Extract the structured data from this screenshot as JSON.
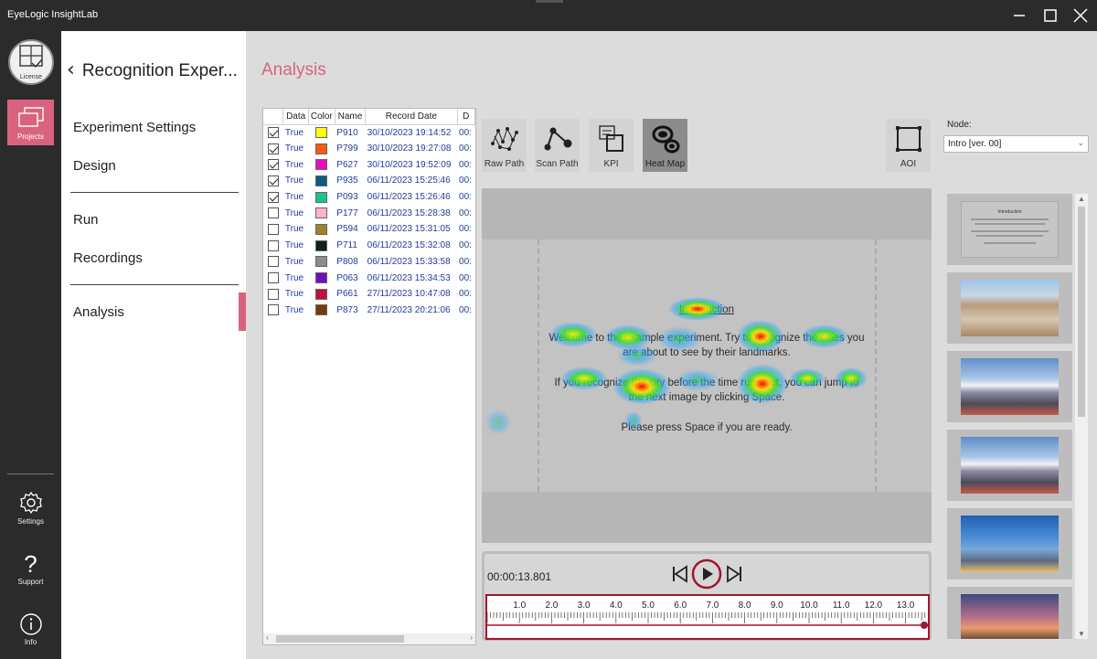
{
  "window": {
    "title": "EyeLogic InsightLab"
  },
  "rail": {
    "license": "License",
    "projects": "Projects",
    "settings": "Settings",
    "support": "Support",
    "info": "Info"
  },
  "sidemenu": {
    "back_title": "Recognition Exper...",
    "items": [
      "Experiment Settings",
      "Design",
      "Run",
      "Recordings",
      "Analysis"
    ]
  },
  "page_title": "Analysis",
  "table": {
    "headers": [
      "Data",
      "Color",
      "Name",
      "Record Date",
      "D"
    ],
    "rows": [
      {
        "checked": true,
        "data": "True",
        "color": "#ffff00",
        "name": "P910",
        "date": "30/10/2023 19:14:52",
        "d": "00:"
      },
      {
        "checked": true,
        "data": "True",
        "color": "#ff5a14",
        "name": "P799",
        "date": "30/10/2023 19:27:08",
        "d": "00:"
      },
      {
        "checked": true,
        "data": "True",
        "color": "#e60fbe",
        "name": "P627",
        "date": "30/10/2023 19:52:09",
        "d": "00:"
      },
      {
        "checked": true,
        "data": "True",
        "color": "#0f5a82",
        "name": "P935",
        "date": "06/11/2023 15:25:46",
        "d": "00:"
      },
      {
        "checked": true,
        "data": "True",
        "color": "#19c38c",
        "name": "P093",
        "date": "06/11/2023 15:26:46",
        "d": "00:"
      },
      {
        "checked": false,
        "data": "True",
        "color": "#ffb4c8",
        "name": "P177",
        "date": "06/11/2023 15:28:38",
        "d": "00:"
      },
      {
        "checked": false,
        "data": "True",
        "color": "#a08228",
        "name": "P594",
        "date": "06/11/2023 15:31:05",
        "d": "00:"
      },
      {
        "checked": false,
        "data": "True",
        "color": "#0f1e1e",
        "name": "P711",
        "date": "06/11/2023 15:32:08",
        "d": "00:"
      },
      {
        "checked": false,
        "data": "True",
        "color": "#8c8c8c",
        "name": "P808",
        "date": "06/11/2023 15:33:58",
        "d": "00:"
      },
      {
        "checked": false,
        "data": "True",
        "color": "#6e0fbe",
        "name": "P063",
        "date": "06/11/2023 15:34:53",
        "d": "00:"
      },
      {
        "checked": false,
        "data": "True",
        "color": "#c30f3c",
        "name": "P661",
        "date": "27/11/2023 10:47:08",
        "d": "00:"
      },
      {
        "checked": false,
        "data": "True",
        "color": "#783c0a",
        "name": "P873",
        "date": "27/11/2023 20:21:06",
        "d": "00:"
      }
    ]
  },
  "tools": {
    "raw_path": "Raw Path",
    "scan_path": "Scan Path",
    "kpi": "KPI",
    "heat_map": "Heat Map",
    "aoi": "AOI"
  },
  "node": {
    "label": "Node:",
    "value": "Intro [ver. 00]"
  },
  "slide": {
    "heading": "Introduction",
    "line1": "Welcome to the example experiment. Try to recognize the cities you",
    "line2": "are about to see by their landmarks.",
    "line3": "If you recognize the city before the time runs out, you can jump to",
    "line4": "the next image by clicking Space.",
    "line5": "Please press Space if you are ready."
  },
  "player": {
    "time": "00:00:13.801",
    "ticks": [
      "1.0",
      "2.0",
      "3.0",
      "4.0",
      "5.0",
      "6.0",
      "7.0",
      "8.0",
      "9.0",
      "10.0",
      "11.0",
      "12.0",
      "13.0"
    ],
    "progress": 1.0
  },
  "thumbnails": [
    {
      "name": "intro-slide",
      "text": "Introduction"
    },
    {
      "name": "city-1",
      "text": ""
    },
    {
      "name": "city-2",
      "text": ""
    },
    {
      "name": "city-3",
      "text": ""
    },
    {
      "name": "city-4",
      "text": ""
    },
    {
      "name": "city-5",
      "text": ""
    }
  ],
  "colors": {
    "accent": "#d9637e",
    "timeline": "#a01530",
    "link": "#1f3d9c"
  }
}
